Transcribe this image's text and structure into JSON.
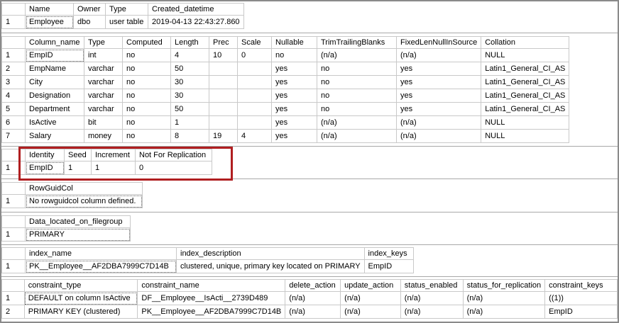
{
  "colors": {
    "null_cell_bg": "#FFFFE1",
    "selected_cell_bg": "#E9EEF4",
    "annotation_box_red": "#B01E20",
    "grid_line": "#C9C9C9",
    "outer_border": "#8A8A8A"
  },
  "grids": [
    {
      "title": "table-info",
      "columns": [
        "Name",
        "Owner",
        "Type",
        "Created_datetime"
      ],
      "rows": [
        [
          "1",
          "Employee",
          "dbo",
          "user table",
          "2019-04-13 22:43:27.860"
        ]
      ]
    },
    {
      "title": "columns-info",
      "columns": [
        "Column_name",
        "Type",
        "Computed",
        "Length",
        "Prec",
        "Scale",
        "Nullable",
        "TrimTrailingBlanks",
        "FixedLenNullInSource",
        "Collation"
      ],
      "rows": [
        [
          "1",
          "EmpID",
          "int",
          "no",
          "4",
          "10",
          "0",
          "no",
          "(n/a)",
          "(n/a)",
          "NULL"
        ],
        [
          "2",
          "EmpName",
          "varchar",
          "no",
          "50",
          "",
          "",
          "yes",
          "no",
          "yes",
          "Latin1_General_CI_AS"
        ],
        [
          "3",
          "City",
          "varchar",
          "no",
          "30",
          "",
          "",
          "yes",
          "no",
          "yes",
          "Latin1_General_CI_AS"
        ],
        [
          "4",
          "Designation",
          "varchar",
          "no",
          "30",
          "",
          "",
          "yes",
          "no",
          "yes",
          "Latin1_General_CI_AS"
        ],
        [
          "5",
          "Department",
          "varchar",
          "no",
          "50",
          "",
          "",
          "yes",
          "no",
          "yes",
          "Latin1_General_CI_AS"
        ],
        [
          "6",
          "IsActive",
          "bit",
          "no",
          "1",
          "",
          "",
          "yes",
          "(n/a)",
          "(n/a)",
          "NULL"
        ],
        [
          "7",
          "Salary",
          "money",
          "no",
          "8",
          "19",
          "4",
          "yes",
          "(n/a)",
          "(n/a)",
          "NULL"
        ]
      ]
    },
    {
      "title": "identity-info",
      "columns": [
        "Identity",
        "Seed",
        "Increment",
        "Not For Replication"
      ],
      "rows": [
        [
          "1",
          "EmpID",
          "1",
          "1",
          "0"
        ]
      ]
    },
    {
      "title": "rowguidcol-info",
      "columns": [
        "RowGuidCol"
      ],
      "rows": [
        [
          "1",
          "No rowguidcol column defined."
        ]
      ]
    },
    {
      "title": "filegroup-info",
      "columns": [
        "Data_located_on_filegroup"
      ],
      "rows": [
        [
          "1",
          "PRIMARY"
        ]
      ]
    },
    {
      "title": "index-info",
      "columns": [
        "index_name",
        "index_description",
        "index_keys"
      ],
      "rows": [
        [
          "1",
          "PK__Employee__AF2DBA7999C7D14B",
          "clustered, unique, primary key located on PRIMARY",
          "EmpID"
        ]
      ]
    },
    {
      "title": "constraint-info",
      "columns": [
        "constraint_type",
        "constraint_name",
        "delete_action",
        "update_action",
        "status_enabled",
        "status_for_replication",
        "constraint_keys"
      ],
      "rows": [
        [
          "1",
          "DEFAULT on column IsActive",
          "DF__Employee__IsActi__2739D489",
          "(n/a)",
          "(n/a)",
          "(n/a)",
          "(n/a)",
          "((1))"
        ],
        [
          "2",
          "PRIMARY KEY (clustered)",
          "PK__Employee__AF2DBA7999C7D14B",
          "(n/a)",
          "(n/a)",
          "(n/a)",
          "(n/a)",
          "EmpID"
        ]
      ]
    }
  ]
}
